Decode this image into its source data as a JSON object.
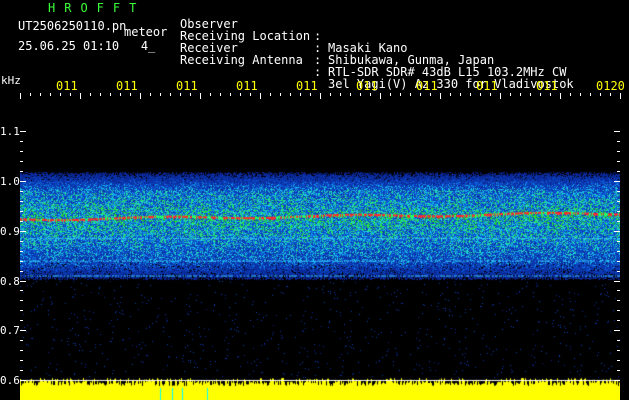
{
  "header": {
    "app_title": "HROFFT",
    "file_name": "UT2506250110.pn",
    "file_tag": "meteor",
    "date_time": "25.06.25 01:10   4_"
  },
  "info": [
    {
      "label": "Observer",
      "value": "Masaki Kano"
    },
    {
      "label": "Receiving Location",
      "value": "Shibukawa, Gunma, Japan"
    },
    {
      "label": "Receiver",
      "value": "RTL-SDR SDR# 43dB L15 103.2MHz CW"
    },
    {
      "label": "Receiving Antenna",
      "value": "3el Yagi(V) Az 330 for Vladivostok"
    }
  ],
  "info_separator": ":",
  "spectrogram": {
    "unit_label": "kHz",
    "time_labels": [
      "011",
      "011",
      "011",
      "011",
      "011",
      "011",
      "011",
      "011",
      "011",
      "0120"
    ],
    "y_ticks": [
      "1.1",
      "1.0",
      "0.9",
      "0.8",
      "0.7",
      "0.6"
    ],
    "y_range": [
      0.6,
      1.1
    ],
    "signal_band_khz": 0.925,
    "colors": {
      "background": "#000000",
      "noise_low": "#0a1f9c",
      "noise_high": "#1ec8ff",
      "signal": "#ff2a2a",
      "level_bar": "#ffff00",
      "axis_lines": "#ffffff"
    }
  }
}
